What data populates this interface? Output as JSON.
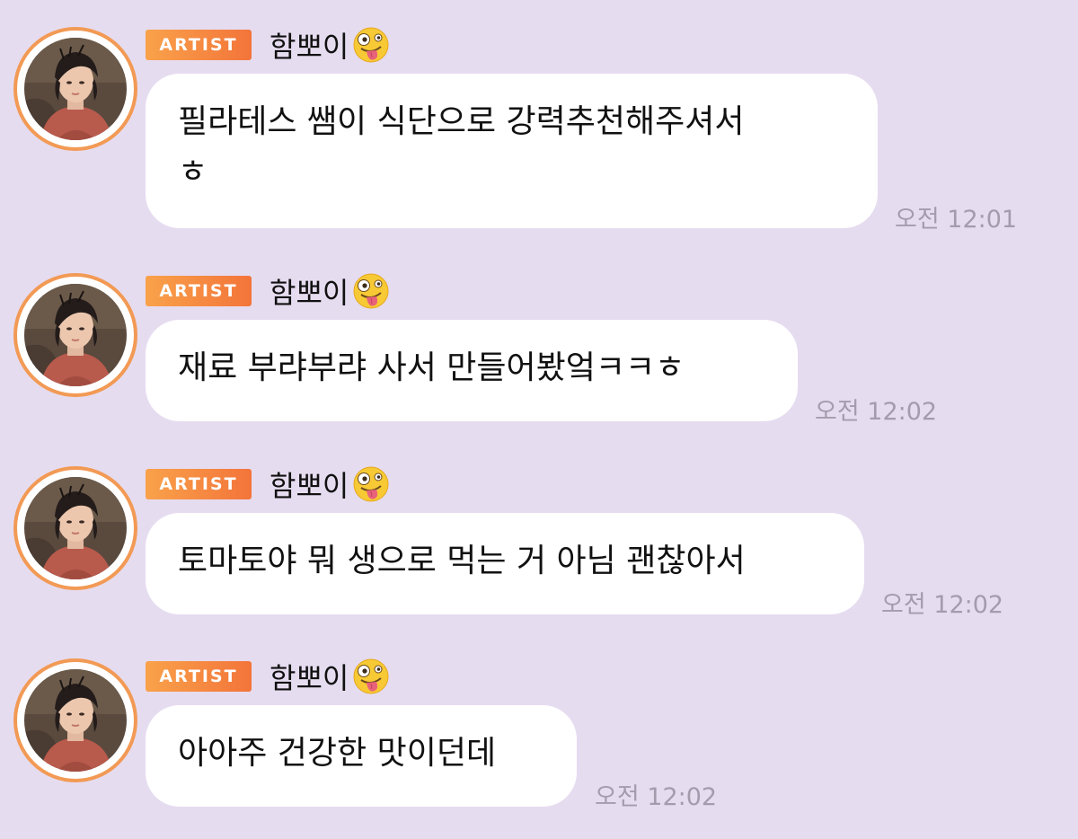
{
  "colors": {
    "background": "#e6dcf0",
    "bubble": "#ffffff",
    "badge_start": "#f9a24a",
    "badge_end": "#f3743a",
    "avatar_ring": "#f29a55",
    "timestamp": "#a49cad"
  },
  "messages": [
    {
      "badge": "ARTIST",
      "sender": "함뽀이",
      "emoji": "zany-face-emoji",
      "text_line1": "필라테스 쌤이 식단으로 강력추천해주셔서",
      "text_line2": "ㅎ",
      "time": "오전 12:01"
    },
    {
      "badge": "ARTIST",
      "sender": "함뽀이",
      "emoji": "zany-face-emoji",
      "text_line1": "재료 부랴부랴 사서 만들어봤엌ㅋㅋㅎ",
      "time": "오전 12:02"
    },
    {
      "badge": "ARTIST",
      "sender": "함뽀이",
      "emoji": "zany-face-emoji",
      "text_line1": "토마토야 뭐 생으로 먹는 거 아님 괜찮아서",
      "time": "오전 12:02"
    },
    {
      "badge": "ARTIST",
      "sender": "함뽀이",
      "emoji": "zany-face-emoji",
      "text_line1": "아아주 건강한 맛이던데",
      "time": "오전 12:02"
    }
  ]
}
